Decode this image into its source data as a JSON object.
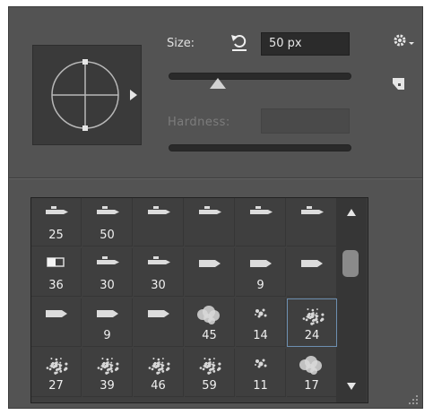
{
  "size": {
    "label": "Size:",
    "value": "50 px",
    "slider_fraction": 0.27
  },
  "hardness": {
    "label": "Hardness:",
    "value": ""
  },
  "brushes": [
    {
      "num": "25",
      "kind": "tip"
    },
    {
      "num": "50",
      "kind": "tip"
    },
    {
      "num": "",
      "kind": "tip"
    },
    {
      "num": "",
      "kind": "tip"
    },
    {
      "num": "",
      "kind": "tip"
    },
    {
      "num": "",
      "kind": "tip"
    },
    {
      "num": "36",
      "kind": "square"
    },
    {
      "num": "30",
      "kind": "tip"
    },
    {
      "num": "30",
      "kind": "tip"
    },
    {
      "num": "",
      "kind": "arrow"
    },
    {
      "num": "9",
      "kind": "arrow"
    },
    {
      "num": "",
      "kind": "arrow"
    },
    {
      "num": "",
      "kind": "arrow"
    },
    {
      "num": "9",
      "kind": "arrow"
    },
    {
      "num": "",
      "kind": "arrow"
    },
    {
      "num": "45",
      "kind": "cloud"
    },
    {
      "num": "14",
      "kind": "speck"
    },
    {
      "num": "24",
      "kind": "scatter",
      "selected": true
    },
    {
      "num": "27",
      "kind": "scatter"
    },
    {
      "num": "39",
      "kind": "scatter"
    },
    {
      "num": "46",
      "kind": "scatter"
    },
    {
      "num": "59",
      "kind": "scatter"
    },
    {
      "num": "11",
      "kind": "speck"
    },
    {
      "num": "17",
      "kind": "cloud"
    }
  ]
}
